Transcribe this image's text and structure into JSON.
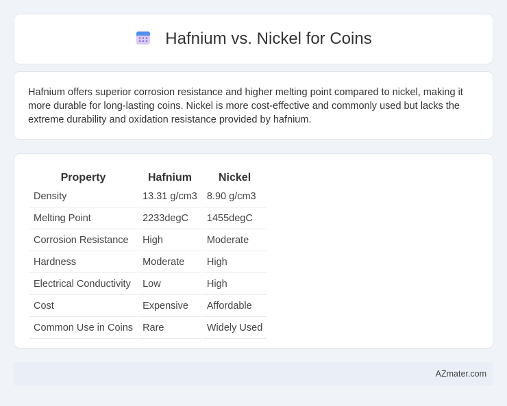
{
  "header": {
    "title": "Hafnium vs. Nickel for Coins",
    "icon": "calendar-icon"
  },
  "summary": {
    "text": "Hafnium offers superior corrosion resistance and higher melting point compared to nickel, making it more durable for long-lasting coins. Nickel is more cost-effective and commonly used but lacks the extreme durability and oxidation resistance provided by hafnium."
  },
  "table": {
    "headers": [
      "Property",
      "Hafnium",
      "Nickel"
    ],
    "rows": [
      [
        "Density",
        "13.31 g/cm3",
        "8.90 g/cm3"
      ],
      [
        "Melting Point",
        "2233degC",
        "1455degC"
      ],
      [
        "Corrosion Resistance",
        "High",
        "Moderate"
      ],
      [
        "Hardness",
        "Moderate",
        "High"
      ],
      [
        "Electrical Conductivity",
        "Low",
        "High"
      ],
      [
        "Cost",
        "Expensive",
        "Affordable"
      ],
      [
        "Common Use in Coins",
        "Rare",
        "Widely Used"
      ]
    ]
  },
  "footer": {
    "site": "AZmater.com"
  },
  "colors": {
    "background": "#f0f3f8",
    "icon_top": "#4f8df0",
    "icon_body": "#c8b8f0"
  }
}
